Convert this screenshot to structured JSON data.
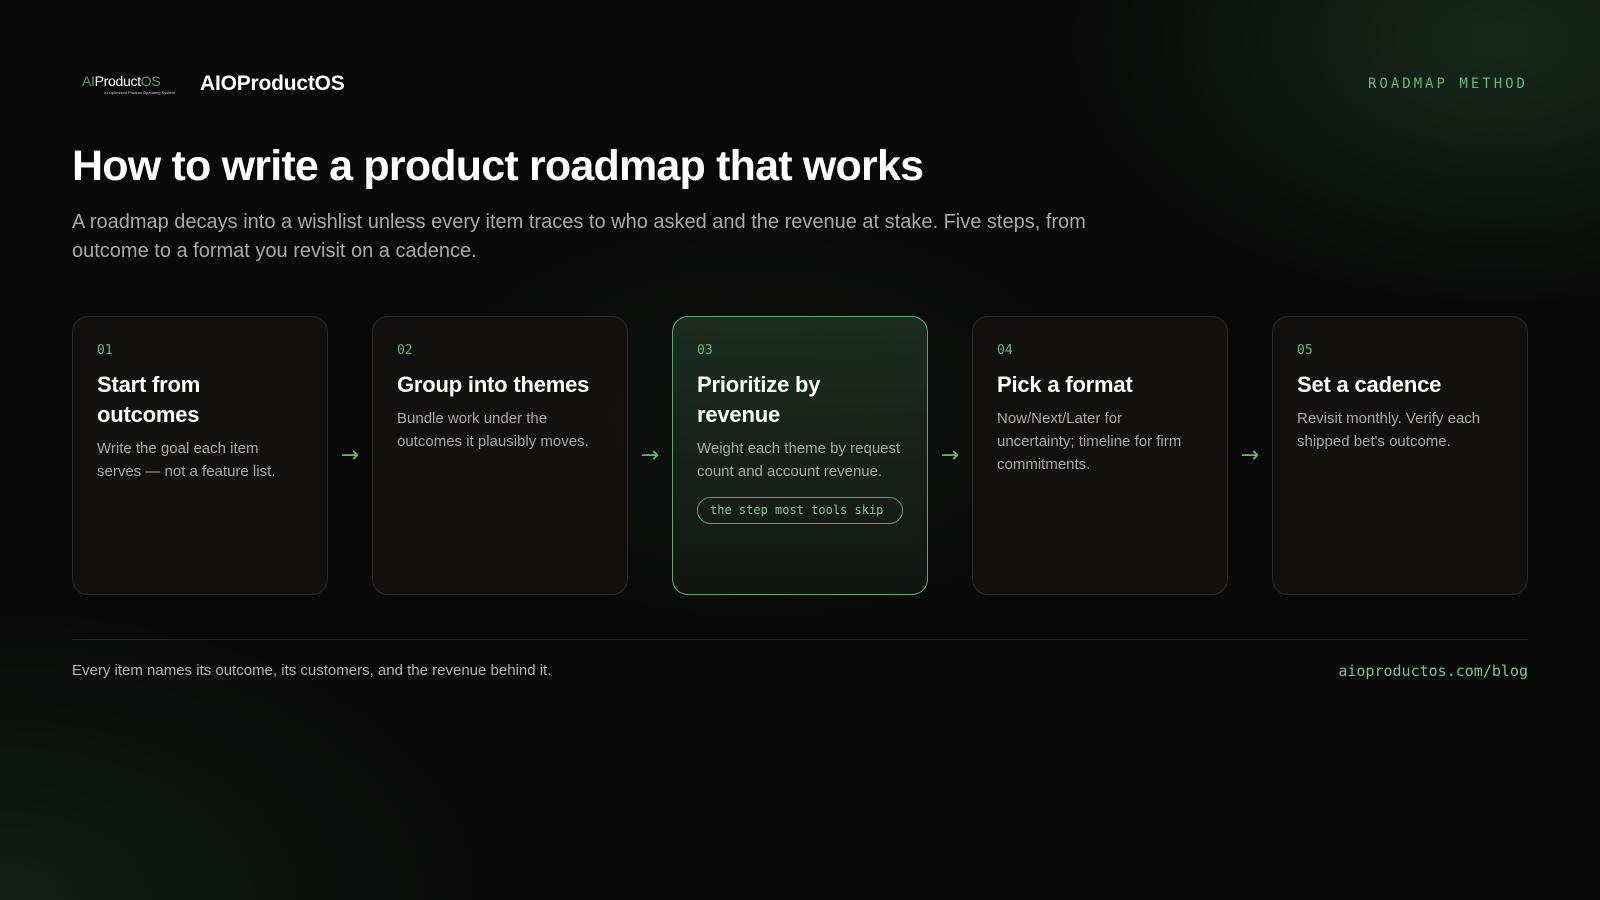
{
  "header": {
    "logo": {
      "prefix": "AI",
      "main": "Product",
      "suffix": "OS",
      "tagline": "AI Optimized Product Operating System"
    },
    "brand_name": "AIOProductOS",
    "kicker": "ROADMAP METHOD"
  },
  "hero": {
    "title": "How to write a product roadmap that works",
    "subtitle": "A roadmap decays into a wishlist unless every item traces to who asked and the revenue at stake. Five steps, from outcome to a format you revisit on a cadence."
  },
  "steps": [
    {
      "number": "01",
      "title": "Start from outcomes",
      "description": "Write the goal each item serves — not a feature list."
    },
    {
      "number": "02",
      "title": "Group into themes",
      "description": "Bundle work under the outcomes it plausibly moves."
    },
    {
      "number": "03",
      "title": "Prioritize by revenue",
      "description": "Weight each theme by request count and account revenue.",
      "tag": "the step most tools skip"
    },
    {
      "number": "04",
      "title": "Pick a format",
      "description": "Now/Next/Later for uncertainty; timeline for firm commitments."
    },
    {
      "number": "05",
      "title": "Set a cadence",
      "description": "Revisit monthly. Verify each shipped bet's outcome."
    }
  ],
  "arrow_glyph": "→",
  "footer": {
    "note": "Every item names its outcome, its customers, and the revenue behind it.",
    "link": "aioproductos.com/blog"
  },
  "colors": {
    "accent": "#63b874",
    "background": "#080808",
    "highlight_border": "#5da86a"
  }
}
